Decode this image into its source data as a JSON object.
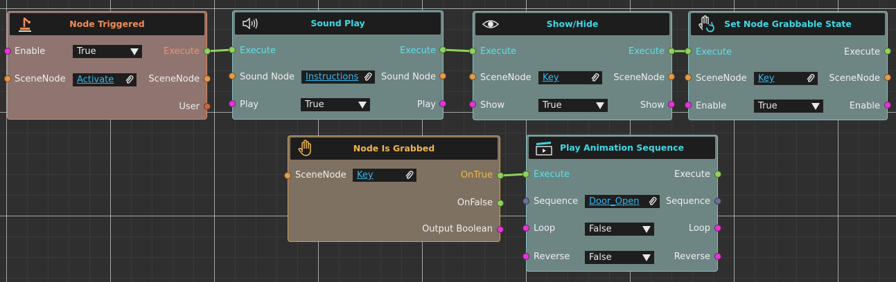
{
  "nodes": {
    "node_triggered": {
      "title": "Node Triggered",
      "icon": "lever-icon",
      "enable_label": "Enable",
      "enable_value": "True",
      "execute_out": "Execute",
      "scenenode_in": "SceneNode",
      "scenenode_value": "Activate",
      "scenenode_out": "SceneNode",
      "user_out": "User"
    },
    "sound_play": {
      "title": "Sound Play",
      "icon": "speaker-icon",
      "execute_in": "Execute",
      "execute_out": "Execute",
      "sound_node_in": "Sound Node",
      "sound_node_value": "Instructions",
      "sound_node_out": "Sound Node",
      "play_in": "Play",
      "play_value": "True",
      "play_out": "Play"
    },
    "show_hide": {
      "title": "Show/Hide",
      "icon": "eye-icon",
      "execute_in": "Execute",
      "execute_out": "Execute",
      "scenenode_in": "SceneNode",
      "scenenode_value": "Key",
      "scenenode_out": "SceneNode",
      "show_in": "Show",
      "show_value": "True",
      "show_out": "Show"
    },
    "grabbable": {
      "title": "Set Node Grabbable State",
      "icon": "hand-rotate-icon",
      "execute_in": "Execute",
      "execute_out": "Execute",
      "scenenode_in": "SceneNode",
      "scenenode_value": "Key",
      "scenenode_out": "SceneNode",
      "enable_in": "Enable",
      "enable_value": "True",
      "enable_out": "Enable"
    },
    "is_grabbed": {
      "title": "Node Is Grabbed",
      "icon": "hand-icon",
      "scenenode_in": "SceneNode",
      "scenenode_value": "Key",
      "ontrue_out": "OnTrue",
      "onfalse_out": "OnFalse",
      "bool_out": "Output Boolean"
    },
    "play_anim": {
      "title": "Play Animation Sequence",
      "icon": "clapperboard-icon",
      "execute_in": "Execute",
      "execute_out": "Execute",
      "sequence_in": "Sequence",
      "sequence_value": "Door_Open",
      "sequence_out": "Sequence",
      "loop_in": "Loop",
      "loop_value": "False",
      "loop_out": "Loop",
      "reverse_in": "Reverse",
      "reverse_value": "False",
      "reverse_out": "Reverse"
    }
  },
  "colors": {
    "exec_pin": "#8fd25a",
    "scenenode_pin": "#e59a48",
    "bool_pin": "#e436d6",
    "link_text": "#37b8f0"
  }
}
